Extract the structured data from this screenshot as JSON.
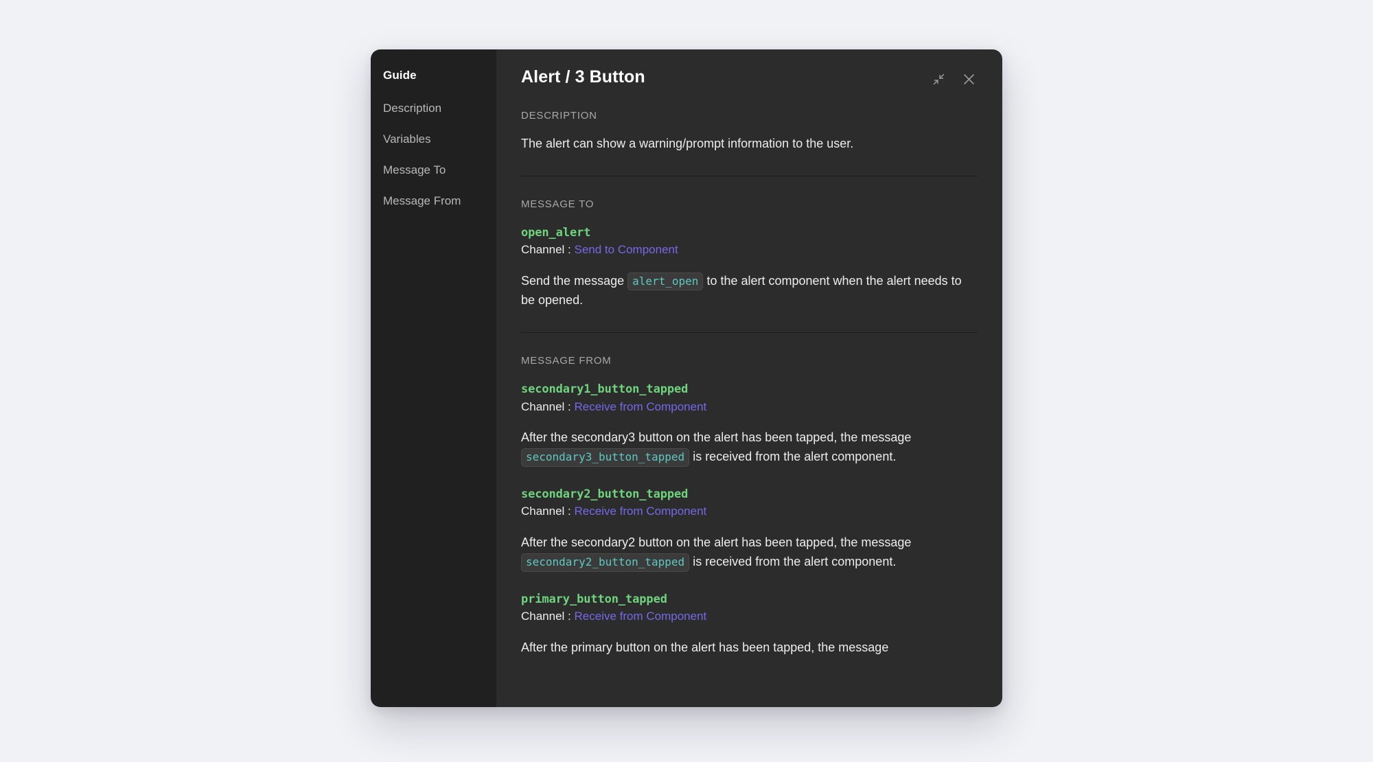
{
  "sidebar": {
    "title": "Guide",
    "items": [
      {
        "label": "Description"
      },
      {
        "label": "Variables"
      },
      {
        "label": "Message To"
      },
      {
        "label": "Message From"
      }
    ]
  },
  "header": {
    "title": "Alert / 3 Button",
    "collapse_icon": "collapse-arrows-icon",
    "close_icon": "close-icon"
  },
  "sections": {
    "description": {
      "label": "DESCRIPTION",
      "text": "The alert can show a warning/prompt information to the user."
    },
    "message_to": {
      "label": "MESSAGE TO",
      "entries": [
        {
          "name": "open_alert",
          "channel_label": "Channel : ",
          "channel_value": "Send to Component",
          "desc_before": "Send the message ",
          "desc_code": "alert_open",
          "desc_after": " to the alert component when the alert needs to be opened."
        }
      ]
    },
    "message_from": {
      "label": "MESSAGE FROM",
      "entries": [
        {
          "name": "secondary1_button_tapped",
          "channel_label": "Channel : ",
          "channel_value": "Receive from Component",
          "desc_before": "After the secondary3 button on the alert has been tapped, the message ",
          "desc_code": "secondary3_button_tapped",
          "desc_after": " is received from the alert component."
        },
        {
          "name": "secondary2_button_tapped",
          "channel_label": "Channel : ",
          "channel_value": "Receive from Component",
          "desc_before": "After the secondary2 button on the alert has been tapped, the message ",
          "desc_code": "secondary2_button_tapped",
          "desc_after": " is received from the alert component."
        },
        {
          "name": "primary_button_tapped",
          "channel_label": "Channel : ",
          "channel_value": "Receive from Component",
          "desc_before": "After the primary button on the alert has been tapped, the message",
          "desc_code": "",
          "desc_after": ""
        }
      ]
    }
  },
  "colors": {
    "page_background": "#f1f2f6",
    "sidebar_background": "#202020",
    "content_background": "#2c2c2c",
    "message_name": "#6fd47e",
    "channel_link": "#7668e8",
    "code_text": "#5ec9c1",
    "code_background": "#3b3b3b",
    "divider": "#1b1b1b"
  }
}
